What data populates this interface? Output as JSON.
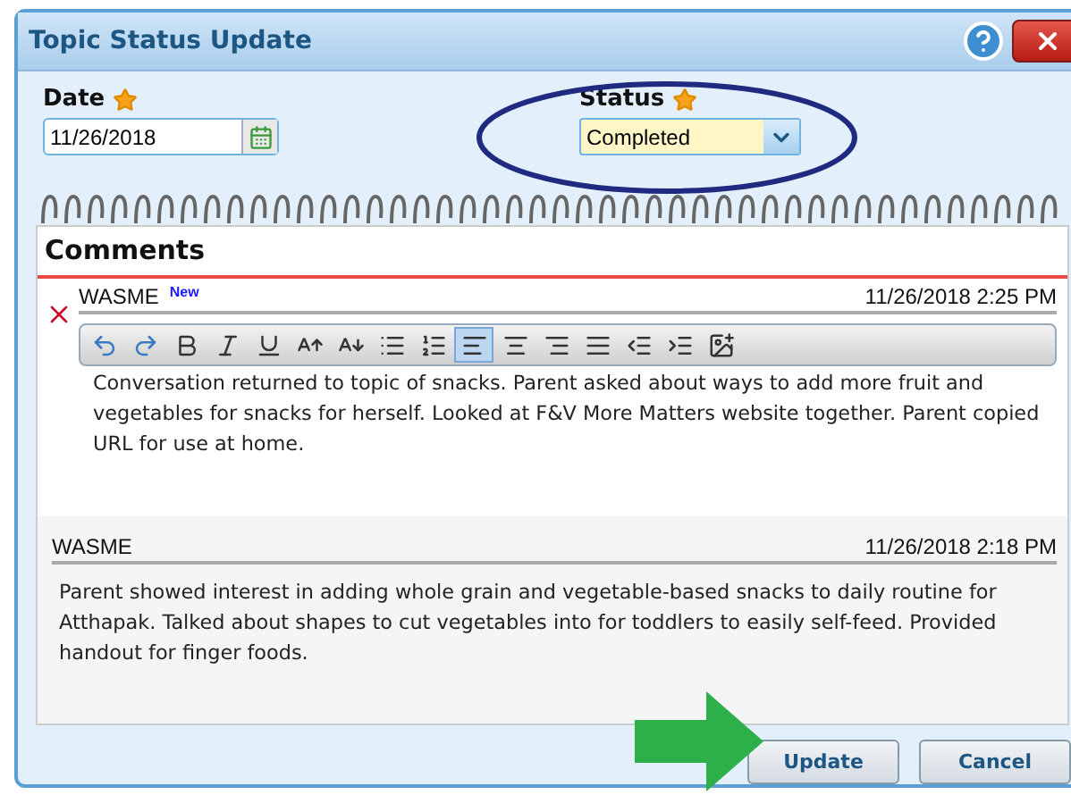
{
  "window": {
    "title": "Topic Status Update"
  },
  "date": {
    "label": "Date",
    "required": true,
    "value": "11/26/2018"
  },
  "status": {
    "label": "Status",
    "required": true,
    "value": "Completed"
  },
  "comments_title": "Comments",
  "toolbar": [
    {
      "kind": "undo",
      "selected": false
    },
    {
      "kind": "redo",
      "selected": false
    },
    {
      "kind": "bold",
      "selected": false
    },
    {
      "kind": "italic",
      "selected": false
    },
    {
      "kind": "underline",
      "selected": false
    },
    {
      "kind": "grow",
      "selected": false
    },
    {
      "kind": "shrink",
      "selected": false
    },
    {
      "kind": "bullets",
      "selected": false
    },
    {
      "kind": "numbers",
      "selected": false
    },
    {
      "kind": "left",
      "selected": true
    },
    {
      "kind": "center",
      "selected": false
    },
    {
      "kind": "right",
      "selected": false
    },
    {
      "kind": "justify",
      "selected": false
    },
    {
      "kind": "outdent",
      "selected": false
    },
    {
      "kind": "indent",
      "selected": false
    },
    {
      "kind": "image",
      "selected": false
    }
  ],
  "comments": [
    {
      "author": "WASME",
      "badge": "New",
      "timestamp": "11/26/2018 2:25 PM",
      "editing": true,
      "text": "Conversation returned to topic of snacks. Parent asked about ways to add more fruit and vegetables for snacks for herself. Looked at F&V More Matters website together. Parent copied URL for use at home."
    },
    {
      "author": "WASME",
      "timestamp": "11/26/2018 2:18 PM",
      "editing": false,
      "text": "Parent showed interest in adding whole grain and vegetable-based snacks to daily routine for Atthapak. Talked about shapes to cut vegetables into for toddlers to easily self-feed. Provided handout for finger foods."
    }
  ],
  "buttons": [
    {
      "label": "Update"
    },
    {
      "label": "Cancel"
    }
  ]
}
